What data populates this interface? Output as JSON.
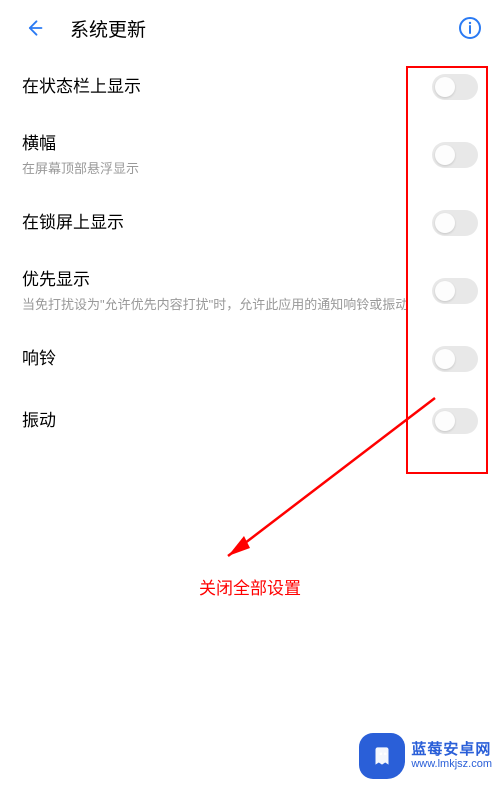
{
  "header": {
    "title": "系统更新"
  },
  "rows": {
    "statusbar": {
      "label": "在状态栏上显示"
    },
    "banner": {
      "label": "横幅",
      "sub": "在屏幕顶部悬浮显示"
    },
    "lockscreen": {
      "label": "在锁屏上显示"
    },
    "priority": {
      "label": "优先显示",
      "sub": "当免打扰设为\"允许优先内容打扰\"时，允许此应用的通知响铃或振动"
    },
    "ring": {
      "label": "响铃"
    },
    "vibrate": {
      "label": "振动"
    }
  },
  "annotation": {
    "text": "关闭全部设置"
  },
  "watermark": {
    "cn": "蓝莓安卓网",
    "url": "www.lmkjsz.com"
  },
  "colors": {
    "accent": "#2a7af3",
    "highlight": "#ff0000"
  }
}
